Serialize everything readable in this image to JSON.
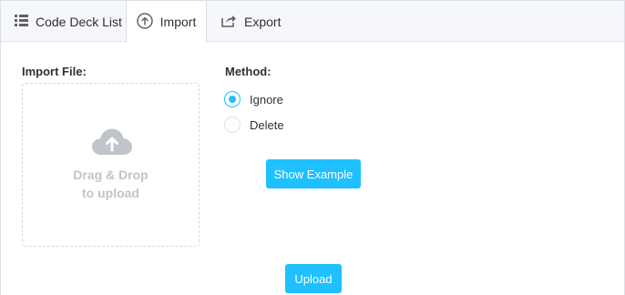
{
  "tabs": [
    {
      "label": "Code Deck List",
      "icon": "list-icon"
    },
    {
      "label": "Import",
      "icon": "upload-circle-icon",
      "active": true
    },
    {
      "label": "Export",
      "icon": "share-icon"
    }
  ],
  "import_file": {
    "label": "Import File:",
    "dropzone_line1": "Drag & Drop",
    "dropzone_line2": "to upload",
    "icon": "cloud-upload-icon"
  },
  "method": {
    "label": "Method:",
    "options": [
      {
        "label": "Ignore",
        "selected": true
      },
      {
        "label": "Delete",
        "selected": false
      }
    ]
  },
  "buttons": {
    "show_example": "Show Example",
    "upload": "Upload"
  },
  "colors": {
    "accent": "#1ec0ff",
    "tabbar_bg": "#f5f7fa",
    "muted_text": "#c0c4cc"
  }
}
